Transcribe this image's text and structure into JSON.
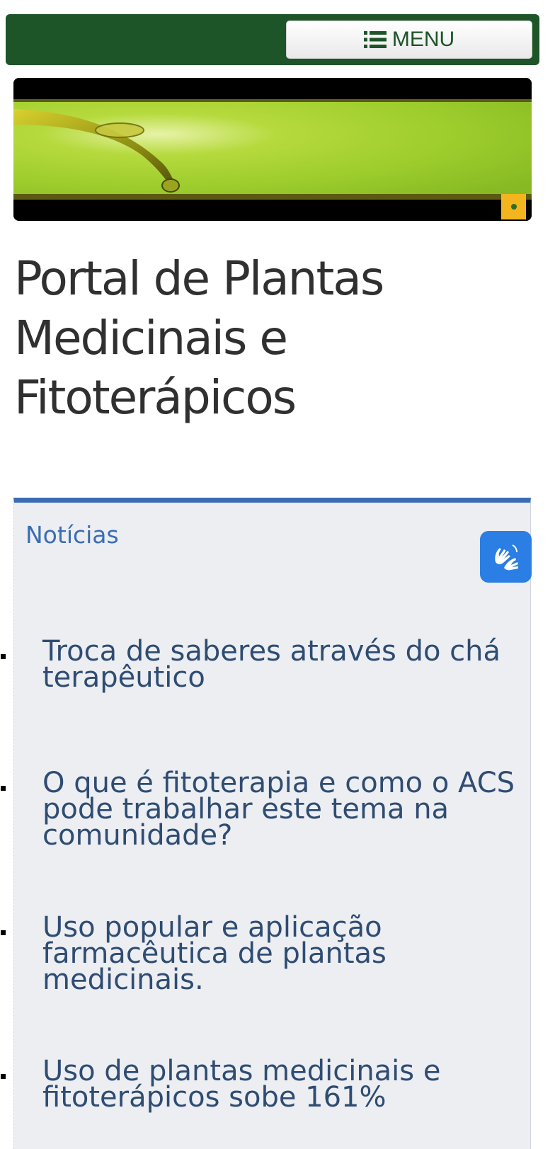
{
  "header": {
    "menu_label": "MENU",
    "menu_icon": "list-icon",
    "bar_color": "#1d5428"
  },
  "banner": {
    "image": "green-leaf-water-drop-banner",
    "indicator_color": "#f3b51e"
  },
  "site": {
    "title": "Portal de Plantas Medicinais e Fitoterápicos"
  },
  "news": {
    "heading": "Notícias",
    "accent_color": "#3a6db4",
    "items": [
      {
        "title": "Troca de saberes através do chá terapêutico"
      },
      {
        "title": "O que é fitoterapia e como o ACS pode trabalhar este tema na comunidade?"
      },
      {
        "title": "Uso popular e aplicação farmacêutica de plantas medicinais."
      },
      {
        "title": "Uso de plantas medicinais e fitoterápicos sobe 161%"
      }
    ]
  },
  "accessibility": {
    "vlibras_icon": "sign-language-hands-icon",
    "button_color": "#2b7ee3"
  }
}
